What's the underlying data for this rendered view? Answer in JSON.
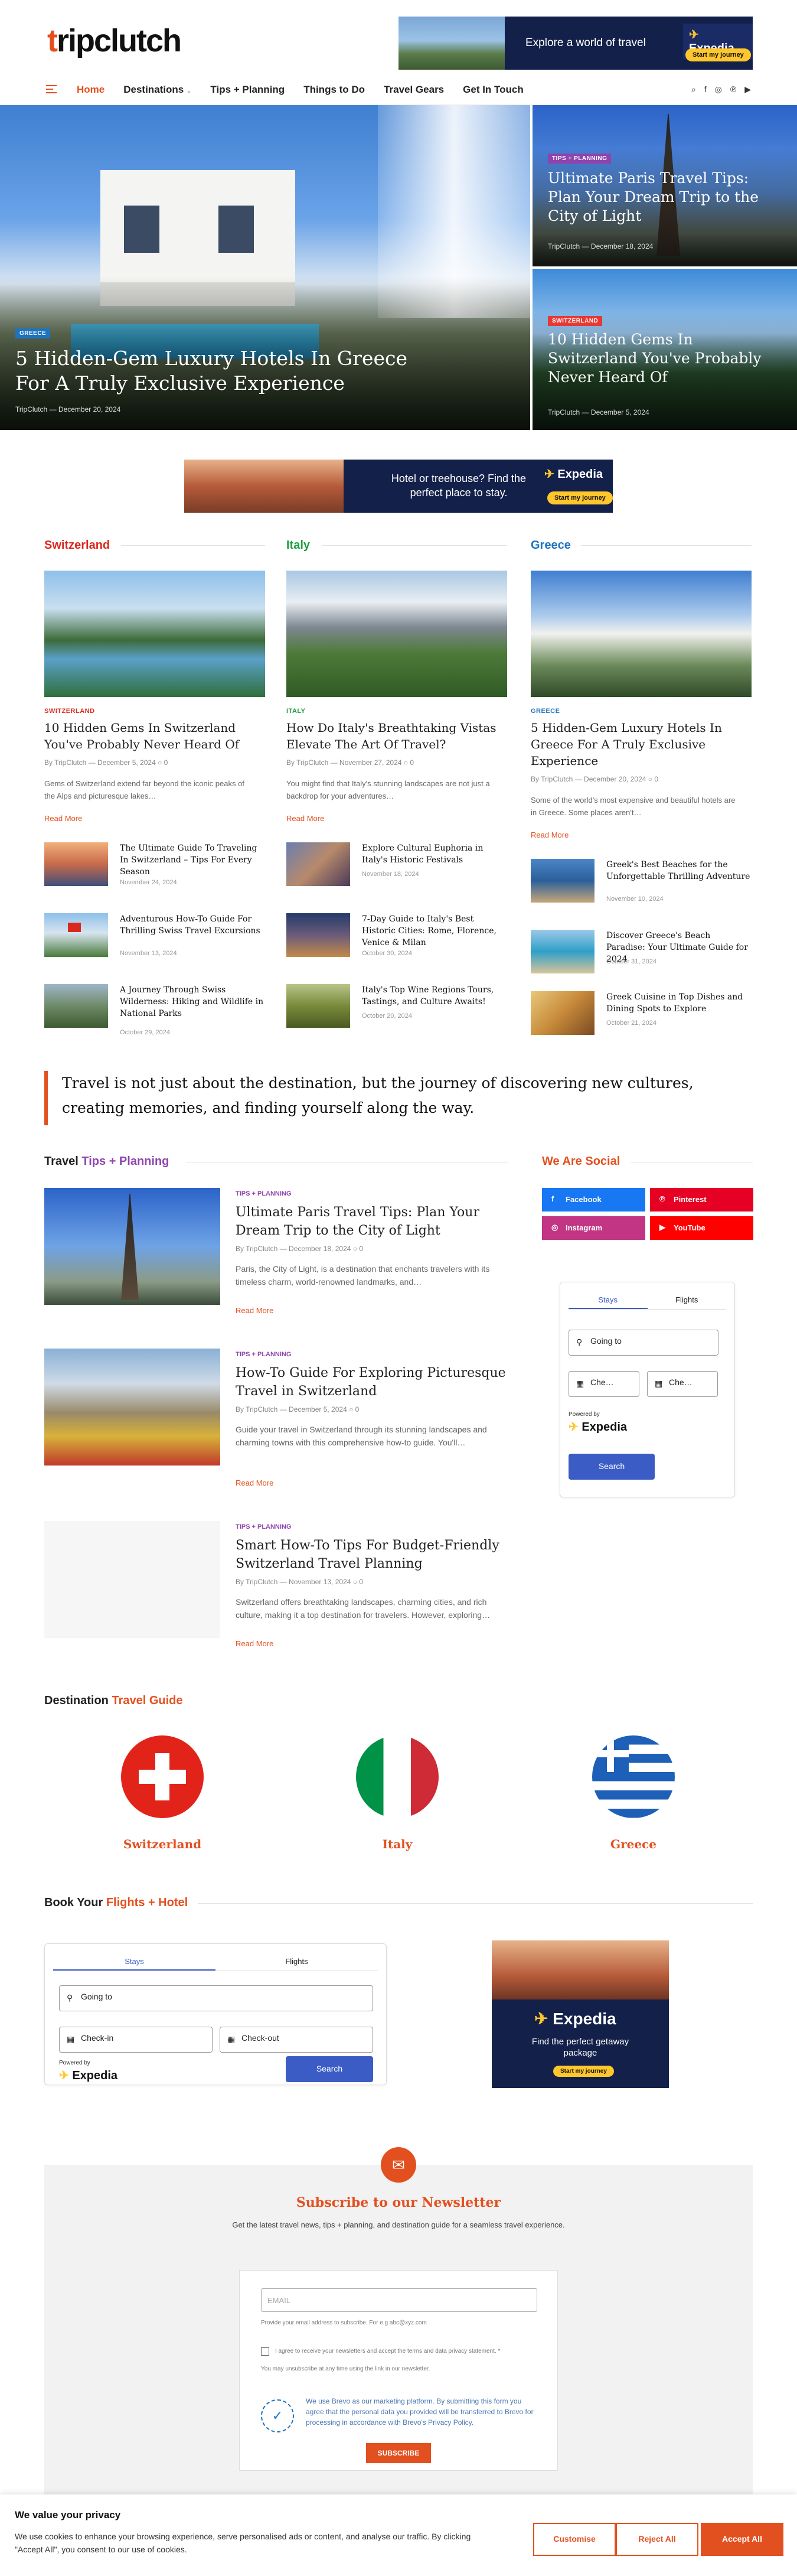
{
  "site": {
    "logo_t": "t",
    "logo_rest": "ripclutch"
  },
  "top_ad": {
    "text": "Explore a world of travel",
    "brand_prefix": "✈ ",
    "brand": "Expedia",
    "cta": "Start my journey"
  },
  "nav": {
    "items": [
      "Home",
      "Destinations",
      "Tips + Planning",
      "Things to Do",
      "Travel Gears",
      "Get In Touch"
    ],
    "icons": [
      "search-icon",
      "facebook-icon",
      "instagram-icon",
      "pinterest-icon",
      "youtube-icon"
    ]
  },
  "hero": {
    "main": {
      "tag": "GREECE",
      "title": "5 Hidden-Gem Luxury Hotels In Greece For A Truly Exclusive Experience",
      "meta": "TripClutch — December 20, 2024"
    },
    "side1": {
      "tag": "TIPS + PLANNING",
      "title": "Ultimate Paris Travel Tips: Plan Your Dream Trip to the City of Light",
      "meta": "TripClutch — December 18, 2024"
    },
    "side2": {
      "tag": "SWITZERLAND",
      "title": "10 Hidden Gems In Switzerland You've Probably Never Heard Of",
      "meta": "TripClutch — December 5, 2024"
    }
  },
  "mid_ad": {
    "text": "Hotel or treehouse? Find the perfect place to stay.",
    "brand": "Expedia",
    "cta": "Start my journey"
  },
  "columns": [
    {
      "heading": "Switzerland",
      "color": "#d9281e",
      "cat": "SWITZERLAND",
      "title": "10 Hidden Gems In Switzerland You've Probably Never Heard Of",
      "by": "By TripClutch — December 5, 2024 ○ 0",
      "excerpt": "Gems of Switzerland extend far beyond the iconic peaks of the Alps and picturesque lakes…",
      "read_more": "Read More",
      "list": [
        {
          "title": "The Ultimate Guide To Traveling In Switzerland – Tips For Every Season",
          "date": "November 24, 2024"
        },
        {
          "title": "Adventurous How-To Guide For Thrilling Swiss Travel Excursions",
          "date": "November 13, 2024"
        },
        {
          "title": "A Journey Through Swiss Wilderness: Hiking and Wildlife in National Parks",
          "date": "October 29, 2024"
        }
      ]
    },
    {
      "heading": "Italy",
      "color": "#1f9d3f",
      "cat": "ITALY",
      "title": "How Do Italy's Breathtaking Vistas Elevate The Art Of Travel?",
      "by": "By TripClutch — November 27, 2024 ○ 0",
      "excerpt": "You might find that Italy's stunning landscapes are not just a backdrop for your adventures…",
      "read_more": "Read More",
      "list": [
        {
          "title": "Explore Cultural Euphoria in Italy's Historic Festivals",
          "date": "November 18, 2024"
        },
        {
          "title": "7-Day Guide to Italy's Best Historic Cities: Rome, Florence, Venice & Milan",
          "date": "October 30, 2024"
        },
        {
          "title": "Italy's Top Wine Regions Tours, Tastings, and Culture Awaits!",
          "date": "October 20, 2024"
        }
      ]
    },
    {
      "heading": "Greece",
      "color": "#1e73be",
      "cat": "GREECE",
      "title": "5 Hidden-Gem Luxury Hotels In Greece For A Truly Exclusive Experience",
      "by": "By TripClutch — December 20, 2024 ○ 0",
      "excerpt": "Some of the world's most expensive and beautiful hotels are in Greece. Some places aren't…",
      "read_more": "Read More",
      "list": [
        {
          "title": "Greek's Best Beaches for the Unforgettable Thrilling Adventure",
          "date": "November 10, 2024"
        },
        {
          "title": "Discover Greece's Beach Paradise: Your Ultimate Guide for 2024",
          "date": "October 31, 2024"
        },
        {
          "title": "Greek Cuisine in Top Dishes and Dining Spots to Explore",
          "date": "October 21, 2024"
        }
      ]
    }
  ],
  "quote": "Travel is not just about the destination, but the journey of discovering new cultures, creating memories, and finding yourself along the way.",
  "tips_section": {
    "heading_a": "Travel",
    "heading_b": "Tips + Planning",
    "posts": [
      {
        "cat": "TIPS + PLANNING",
        "title": "Ultimate Paris Travel Tips: Plan Your Dream Trip to the City of Light",
        "by": "By TripClutch — December 18, 2024 ○ 0",
        "excerpt": "Paris, the City of Light, is a destination that enchants travelers with its timeless charm, world-renowned landmarks, and…",
        "read_more": "Read More"
      },
      {
        "cat": "TIPS + PLANNING",
        "title": "How-To Guide For Exploring Picturesque Travel in Switzerland",
        "by": "By TripClutch — December 5, 2024 ○ 0",
        "excerpt": "Guide your travel in Switzerland through its stunning landscapes and charming towns with this comprehensive how-to guide. You'll…",
        "read_more": "Read More"
      },
      {
        "cat": "TIPS + PLANNING",
        "title": "Smart How-To Tips For Budget-Friendly Switzerland Travel Planning",
        "by": "By TripClutch — November 13, 2024 ○ 0",
        "excerpt": "Switzerland offers breathtaking landscapes, charming cities, and rich culture, making it a top destination for travelers. However, exploring…",
        "read_more": "Read More"
      }
    ]
  },
  "social": {
    "heading": "We Are Social",
    "buttons": [
      {
        "label": "Facebook",
        "color": "#1877f2",
        "icon": "f"
      },
      {
        "label": "Pinterest",
        "color": "#e60023",
        "icon": "P"
      },
      {
        "label": "Instagram",
        "color": "#c13584",
        "icon": "◎"
      },
      {
        "label": "YouTube",
        "color": "#ff0000",
        "icon": "▶"
      }
    ]
  },
  "widget_small": {
    "tab_stays": "Stays",
    "tab_flights": "Flights",
    "going_to": "Going to",
    "checkin": "Che…",
    "checkout": "Che…",
    "powered": "Powered by",
    "brand": "Expedia",
    "search": "Search"
  },
  "destinations": {
    "heading_a": "Destination",
    "heading_b": "Travel Guide",
    "items": [
      "Switzerland",
      "Italy",
      "Greece"
    ]
  },
  "book": {
    "heading_a": "Book Your",
    "heading_b": "Flights + Hotel",
    "tab_stays": "Stays",
    "tab_flights": "Flights",
    "going_to": "Going to",
    "checkin": "Check-in",
    "checkout": "Check-out",
    "powered": "Powered by",
    "brand": "Expedia",
    "search": "Search",
    "promo": {
      "brand": "Expedia",
      "text": "Find the perfect getaway package",
      "cta": "Start my journey"
    }
  },
  "newsletter": {
    "title": "Subscribe to our Newsletter",
    "sub": "Get the latest travel news, tips + planning, and destination guide for a seamless travel experience.",
    "email_placeholder": "EMAIL",
    "email_help": "Provide your email address to subscribe. For e.g abc@xyz.com",
    "consent": "I agree to receive your newsletters and accept the terms and data privacy statement. *",
    "unsub": "You may unsubscribe at any time using the link in our newsletter.",
    "info": "We use Brevo as our marketing platform. By submitting this form you agree that the personal data you provided will be transferred to Brevo for processing in accordance with Brevo's Privacy Policy.",
    "button": "SUBSCRIBE"
  },
  "cookie": {
    "title": "We value your privacy",
    "text": "We use cookies to enhance your browsing experience, serve personalised ads or content, and analyse our traffic. By clicking \"Accept All\", you consent to our use of cookies.",
    "customise": "Customise",
    "reject": "Reject All",
    "accept": "Accept All"
  },
  "colors": {
    "accent": "#e3501f",
    "purple": "#8e44ad",
    "expedia_navy": "#13214a",
    "expedia_yellow": "#ffc72c",
    "search_blue": "#3b5cc4"
  }
}
